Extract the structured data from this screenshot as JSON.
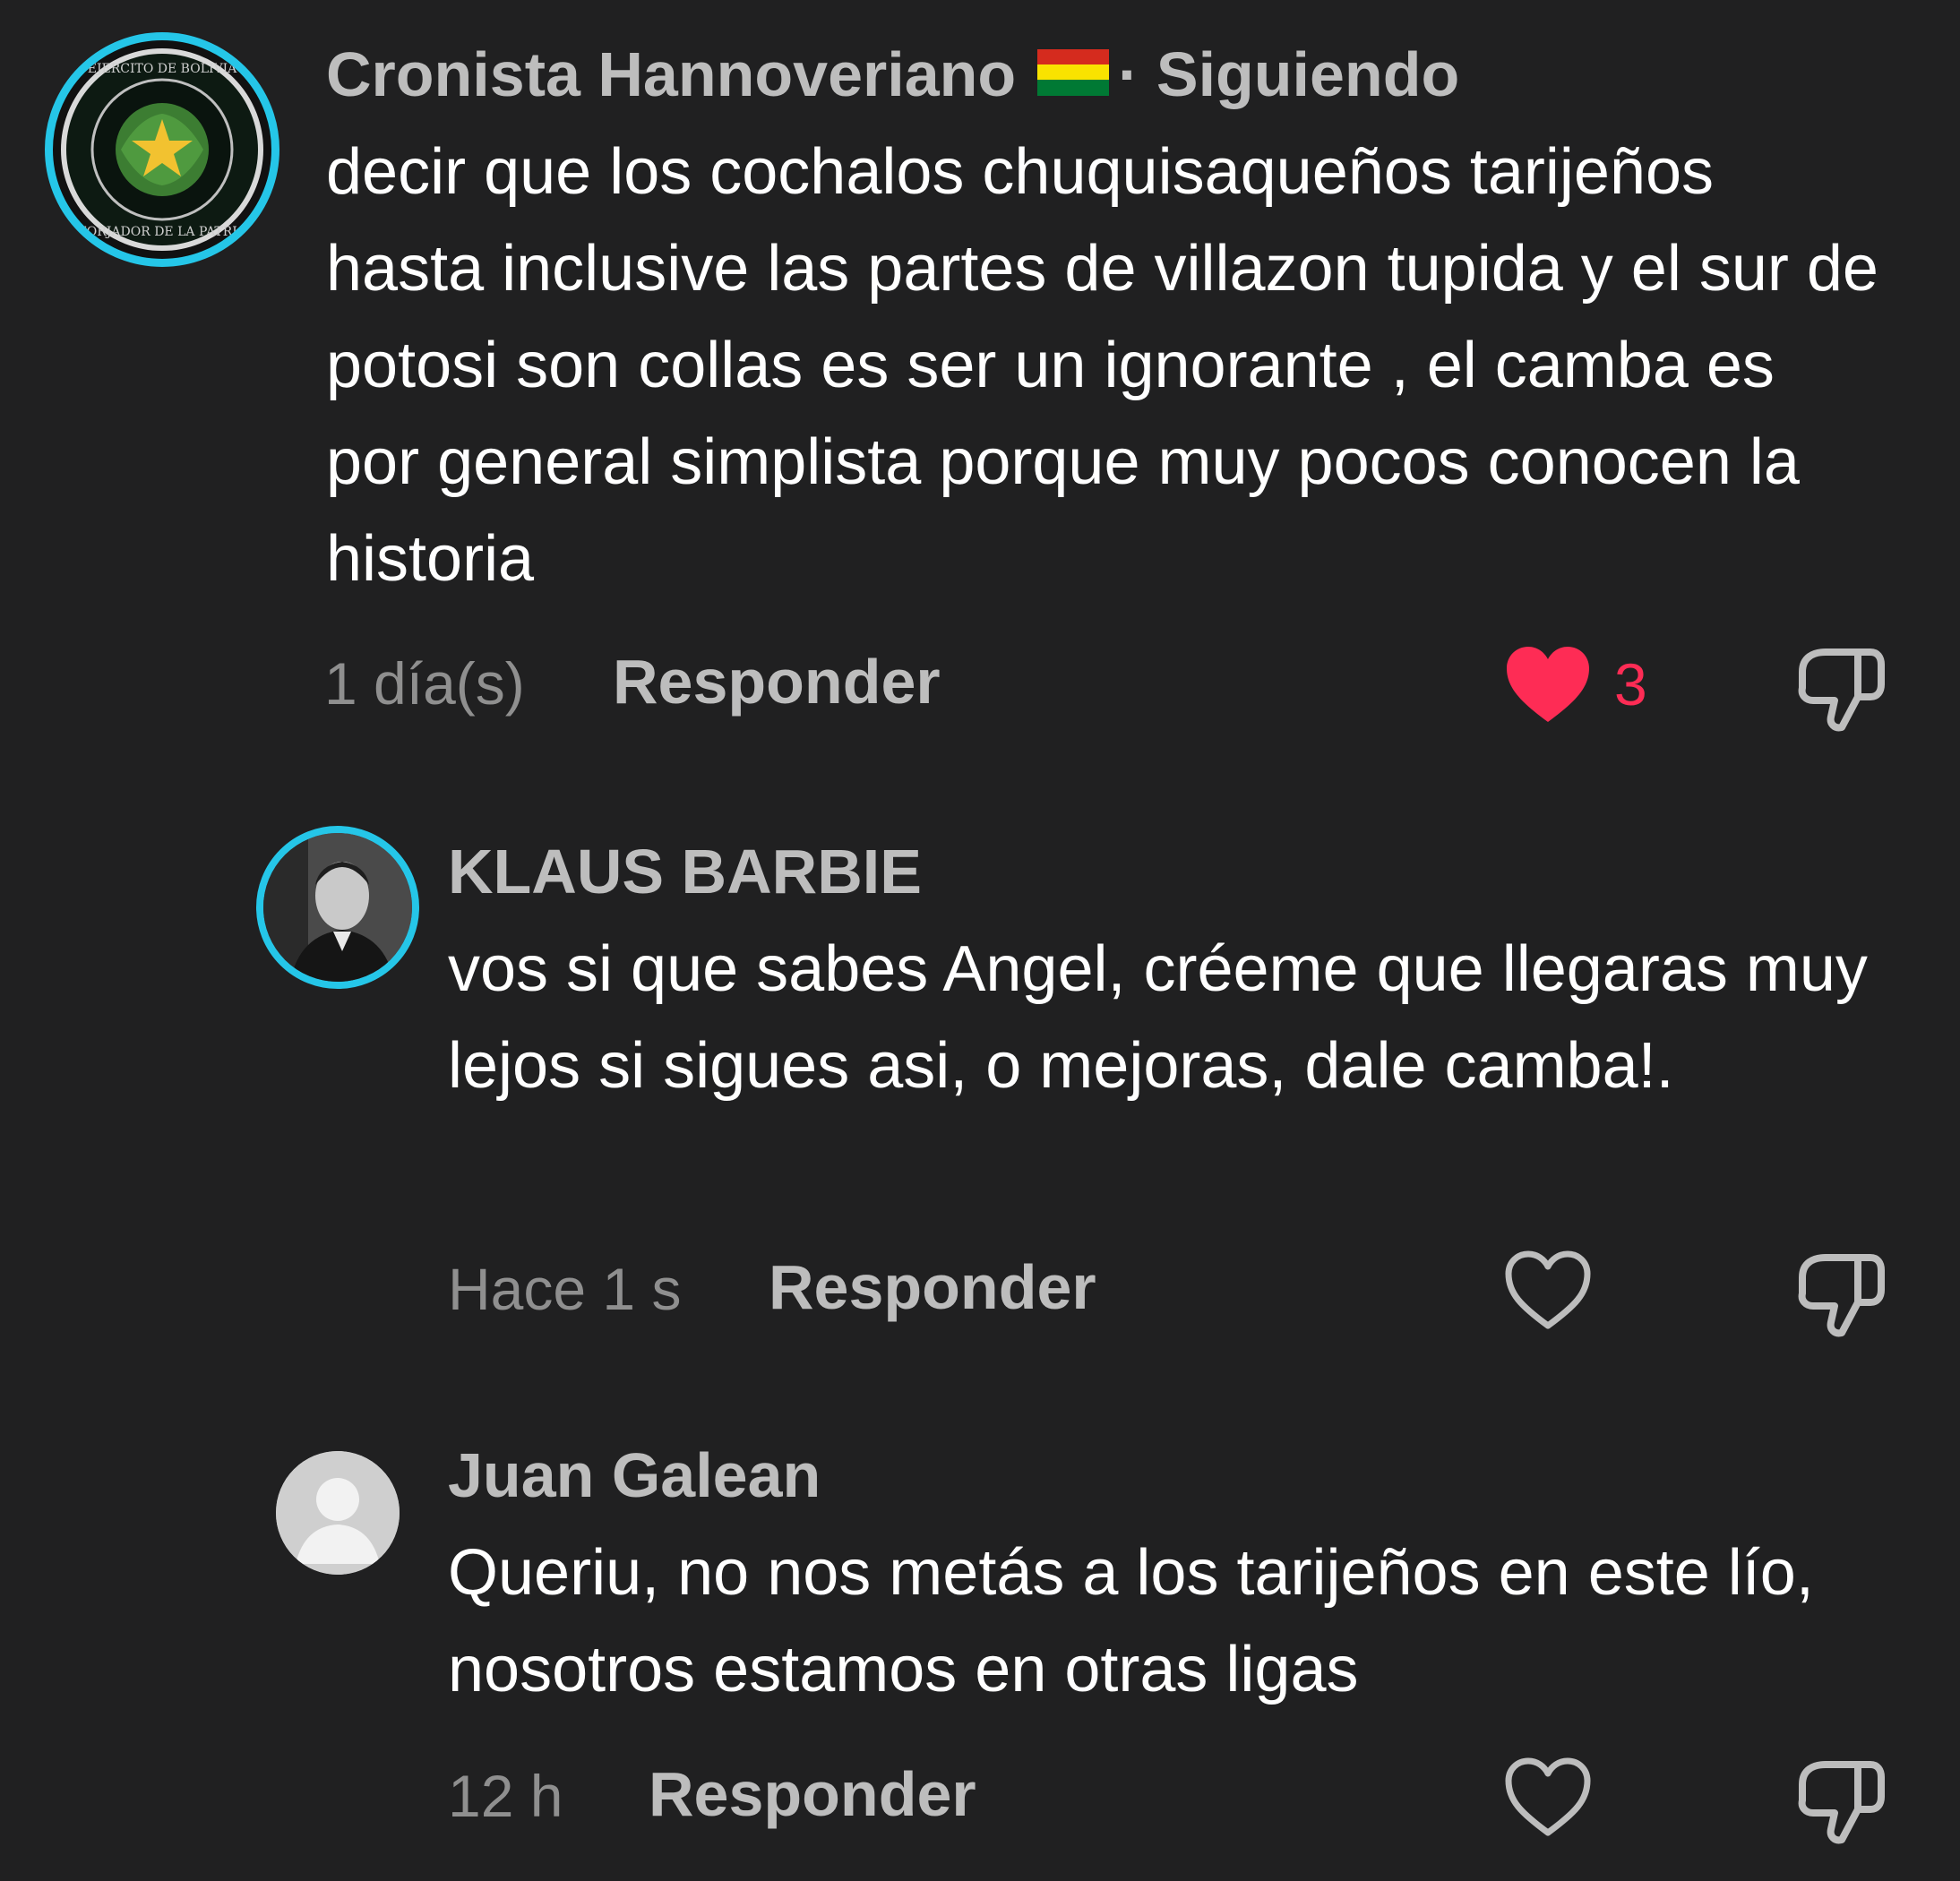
{
  "colors": {
    "background": "#202021",
    "like_active": "#fe2c55",
    "avatar_ring": "#25c6e8"
  },
  "comments": [
    {
      "author": "Cronista Hannoveriano",
      "author_flag": "bolivia-flag",
      "follow_status": "· Siguiendo",
      "text": "decir que los cochalos chuquisaqueños tarijeños hasta inclusive las partes de villazon tupida y el sur de potosi son collas es ser un ignorante , el camba es por general simplista porque muy pocos conocen la historia",
      "time": "1 día(s)",
      "reply_label": "Responder",
      "like_count": "3",
      "liked": true,
      "avatar_icon": "army-emblem-icon"
    },
    {
      "author": "KLAUS BARBIE",
      "text": "vos si que sabes Angel, créeme que llegaras muy lejos si sigues asi, o mejoras, dale camba!.",
      "time": "Hace 1 s",
      "reply_label": "Responder",
      "liked": false,
      "avatar_icon": "portrait-photo-icon"
    },
    {
      "author": "Juan Galean",
      "text": "Queriu, no nos metás a los tarijeños en este lío, nosotros estamos en otras ligas",
      "time": "12 h",
      "reply_label": "Responder",
      "liked": false,
      "avatar_icon": "default-user-icon"
    }
  ]
}
